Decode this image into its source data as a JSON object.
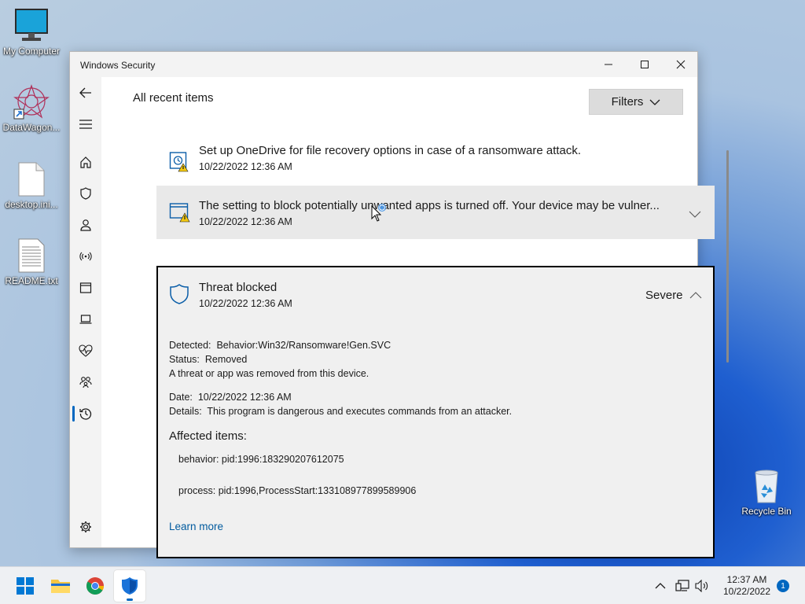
{
  "desktop": {
    "icons": [
      {
        "label": "My Computer",
        "icon": "monitor-icon"
      },
      {
        "label": "DataWagon...",
        "icon": "datawagon-app-icon"
      },
      {
        "label": "desktop.ini...",
        "icon": "file-icon"
      },
      {
        "label": "README.txt",
        "icon": "text-file-icon"
      },
      {
        "label": "Recycle Bin",
        "icon": "recycle-bin-icon"
      }
    ]
  },
  "window": {
    "title": "Windows Security",
    "controls": {
      "minimize": "minimize-icon",
      "maximize": "maximize-icon",
      "close": "close-icon"
    }
  },
  "sidebar": {
    "items": [
      {
        "icon": "back-arrow-icon"
      },
      {
        "icon": "hamburger-menu-icon"
      },
      {
        "icon": "home-icon"
      },
      {
        "icon": "shield-icon"
      },
      {
        "icon": "person-icon"
      },
      {
        "icon": "wireless-icon"
      },
      {
        "icon": "app-browser-icon"
      },
      {
        "icon": "laptop-icon"
      },
      {
        "icon": "heart-pulse-icon"
      },
      {
        "icon": "family-icon"
      },
      {
        "icon": "history-icon",
        "active": true
      },
      {
        "icon": "gear-icon"
      }
    ]
  },
  "main": {
    "heading": "All recent items",
    "filters_label": "Filters",
    "items": [
      {
        "title": "Set up OneDrive for file recovery options in case of a ransomware attack.",
        "date": "10/22/2022 12:36 AM",
        "icon": "folder-protection-warning-icon"
      },
      {
        "title": "The setting to block potentially unwanted apps is turned off. Your device may be vulner...",
        "date": "10/22/2022 12:36 AM",
        "icon": "app-browser-warning-icon"
      },
      {
        "title": "Threat blocked",
        "date": "10/22/2022 12:36 AM",
        "icon": "shield-outline-icon",
        "severity": "Severe"
      }
    ],
    "detail": {
      "detected_label": "Detected:",
      "detected_value": "Behavior:Win32/Ransomware!Gen.SVC",
      "status_label": "Status:",
      "status_value": "Removed",
      "status_note": "A threat or app was removed from this device.",
      "date_label": "Date:",
      "date_value": "10/22/2022 12:36 AM",
      "details_label": "Details:",
      "details_value": "This program is dangerous and executes commands from an attacker.",
      "affected_heading": "Affected items:",
      "affected": [
        "behavior: pid:1996:183290207612075",
        "process: pid:1996,ProcessStart:133108977899589906"
      ],
      "learn_more": "Learn more"
    }
  },
  "taskbar": {
    "apps": [
      {
        "icon": "windows-start-icon"
      },
      {
        "icon": "file-explorer-icon"
      },
      {
        "icon": "chrome-icon"
      },
      {
        "icon": "windows-security-icon",
        "active": true
      }
    ],
    "tray": {
      "icons": [
        "chevron-up-icon",
        "network-icon",
        "volume-icon"
      ]
    },
    "time": "12:37 AM",
    "date": "10/22/2022",
    "notification_count": "1"
  },
  "colors": {
    "accent": "#0067c0",
    "link": "#005a9e",
    "warning": "#f2c811"
  }
}
